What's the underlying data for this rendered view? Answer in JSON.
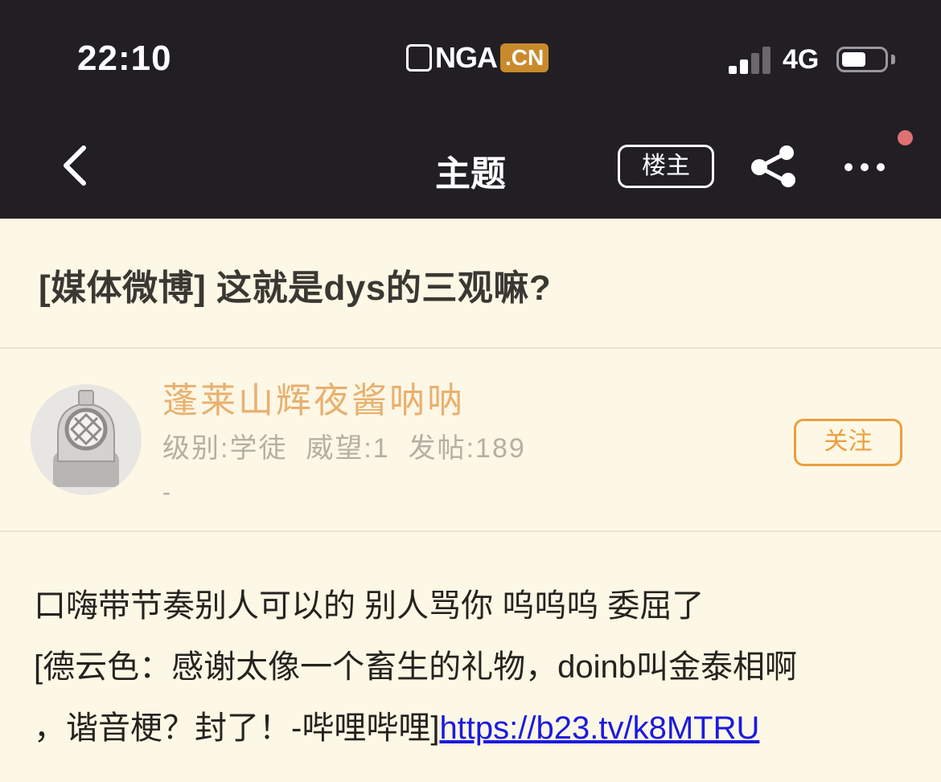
{
  "status_bar": {
    "time": "22:10",
    "logo_text": "NGA",
    "logo_suffix": ".CN",
    "network": "4G",
    "signal_level": 0.5,
    "battery_level": 0.55
  },
  "nav": {
    "back_icon": "chevron-left-icon",
    "title": "主题",
    "louzhu_label": "楼主",
    "share_icon": "share-icon",
    "more_icon": "more-icon",
    "has_notification": true
  },
  "post": {
    "title": "[媒体微博] 这就是dys的三观嘛?"
  },
  "author": {
    "avatar_icon": "diving-helmet-avatar",
    "name": "蓬莱山辉夜酱呐呐",
    "stats": "级别:学徒  威望:1  发帖:189",
    "signature": "-",
    "follow_label": "关注"
  },
  "content": {
    "line1": "口嗨带节奏别人可以的 别人骂你 呜呜呜 委屈了",
    "line2": "[德云色：感谢太像一个畜生的礼物，doinb叫金泰相啊",
    "line3": "，谐音梗？封了！-哔哩哔哩]",
    "link": "https://b23.tv/k8MTRU"
  },
  "colors": {
    "topbar_bg": "#211f24",
    "page_bg": "#fdf7e5",
    "username": "#e8b070",
    "follow_accent": "#ec9f3c",
    "link": "#1a1ae0",
    "notification_dot": "#e07172"
  }
}
